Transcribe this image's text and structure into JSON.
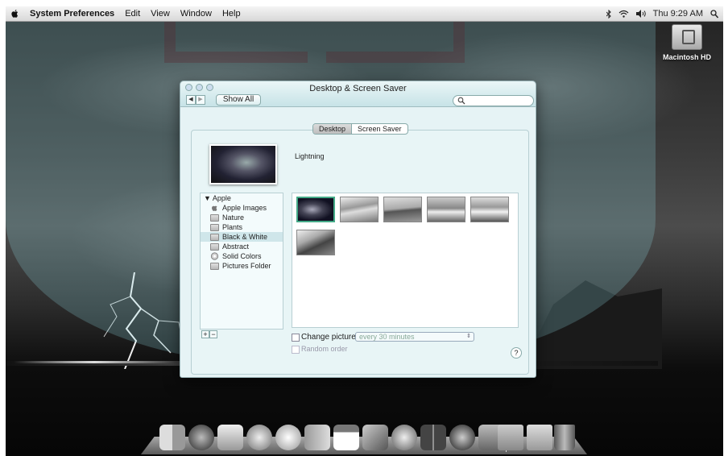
{
  "menubar": {
    "app": "System Preferences",
    "items": [
      "Edit",
      "View",
      "Window",
      "Help"
    ],
    "clock": "Thu 9:29 AM"
  },
  "desktop": {
    "hd_label": "Macintosh HD"
  },
  "window": {
    "title": "Desktop & Screen Saver",
    "show_all": "Show All",
    "search_value": "",
    "tabs": [
      "Desktop",
      "Screen Saver"
    ],
    "selected_tab": "Desktop",
    "preview_name": "Lightning",
    "sidebar": {
      "group": "▼ Apple",
      "items": [
        "Apple Images",
        "Nature",
        "Plants",
        "Black & White",
        "Abstract",
        "Solid Colors",
        "Pictures Folder"
      ],
      "selected": "Black & White"
    },
    "add_label": "+",
    "remove_label": "−",
    "change_picture_label": "Change picture:",
    "interval_value": "every 30 minutes",
    "random_order_label": "Random order",
    "help_label": "?"
  },
  "dock": {
    "items": [
      "finder",
      "dashboard",
      "mail",
      "safari",
      "ichat",
      "address-book",
      "ical",
      "iphoto",
      "itunes",
      "spaces",
      "time-machine",
      "system-preferences",
      "applications-folder",
      "documents-folder",
      "trash"
    ]
  }
}
